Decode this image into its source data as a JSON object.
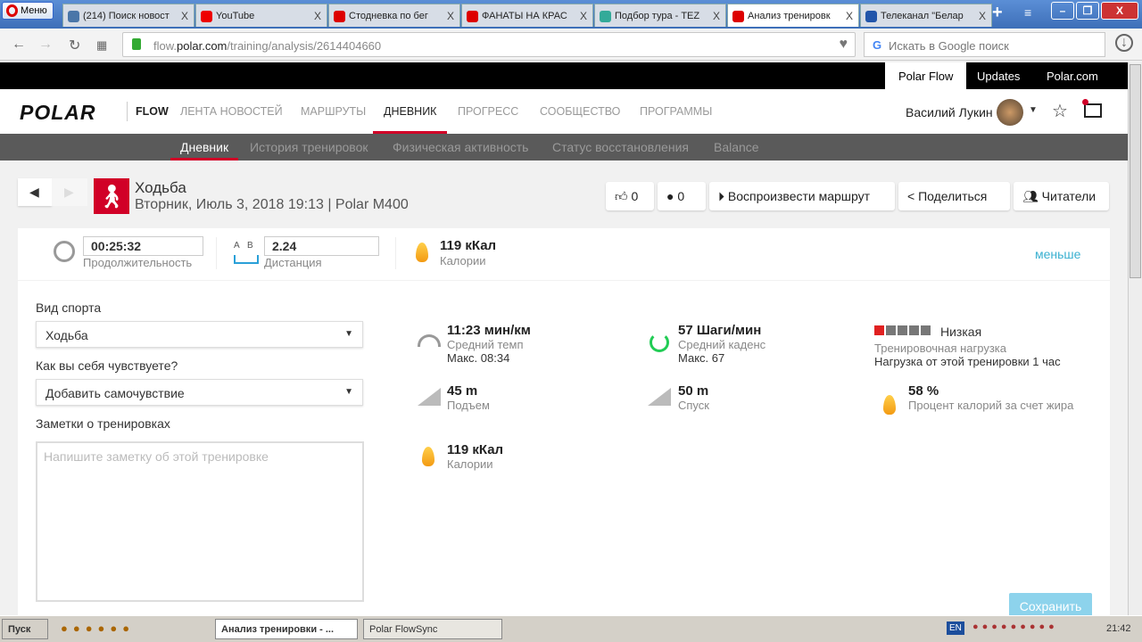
{
  "browser": {
    "menu": "Меню",
    "tabs": [
      {
        "title": "(214) Поиск новост",
        "color": "#4a76a8"
      },
      {
        "title": "YouTube",
        "color": "#e00"
      },
      {
        "title": "Стодневка по бег",
        "color": "#d00"
      },
      {
        "title": "ФАНАТЫ НА КРАС",
        "color": "#d00"
      },
      {
        "title": "Подбор тура - TEZ",
        "color": "#3a9"
      },
      {
        "title": "Анализ тренировк",
        "color": "#d00"
      },
      {
        "title": "Телеканал \"Белар",
        "color": "#25a"
      }
    ],
    "url_host": "flow.polar.com",
    "url_prefix": "flow.",
    "url_domain": "polar.com",
    "url_path": "/training/analysis/2614404660",
    "search_placeholder": "Искать в Google поиск"
  },
  "topbar": [
    "Polar Flow",
    "Updates",
    "Polar.com"
  ],
  "nav": {
    "logo": "POLAR",
    "flow": "FLOW",
    "items": [
      "ЛЕНТА НОВОСТЕЙ",
      "МАРШРУТЫ",
      "ДНЕВНИК",
      "ПРОГРЕСС",
      "СООБЩЕСТВО",
      "ПРОГРАММЫ"
    ],
    "user": "Василий Лукин"
  },
  "subnav": [
    "Дневник",
    "История тренировок",
    "Физическая активность",
    "Статус восстановления",
    "Balance"
  ],
  "session": {
    "sport": "Ходьба",
    "subtitle": "Вторник, Июль 3, 2018 19:13 | Polar M400"
  },
  "actions": {
    "likes": "0",
    "comments": "0",
    "replay": "Воспроизвести маршрут",
    "share": "Поделиться",
    "followers": "Читатели"
  },
  "summary": {
    "duration": "00:25:32",
    "duration_label": "Продолжительность",
    "ab_a": "A",
    "ab_b": "B",
    "distance": "2.24",
    "distance_label": "Дистанция",
    "calories": "119 кКал",
    "calories_label": "Калории",
    "less": "меньше"
  },
  "form": {
    "sport_label": "Вид спорта",
    "sport_value": "Ходьба",
    "feel_label": "Как вы себя чувствуете?",
    "feel_value": "Добавить самочувствие",
    "notes_label": "Заметки о тренировках",
    "notes_placeholder": "Напишите заметку об этой тренировке",
    "save": "Сохранить"
  },
  "stats": {
    "pace": "11:23 мин/км",
    "pace_label": "Средний темп",
    "pace_max": "Макс. 08:34",
    "cadence": "57 Шаги/мин",
    "cadence_label": "Средний каденс",
    "cadence_max": "Макс. 67",
    "load": "Низкая",
    "load_label": "Тренировочная нагрузка",
    "load_desc": "Нагрузка от этой тренировки 1 час",
    "load_level": 1,
    "load_max": 5,
    "ascent": "45 m",
    "ascent_label": "Подъем",
    "descent": "50 m",
    "descent_label": "Спуск",
    "fat": "58 %",
    "fat_label": "Процент калорий за счет жира",
    "cal": "119 кКал",
    "cal_label": "Калории"
  },
  "taskbar": {
    "start": "Пуск",
    "win1": "Анализ тренировки - ...",
    "win2": "Polar FlowSync",
    "lang": "EN",
    "time": "21:42"
  }
}
